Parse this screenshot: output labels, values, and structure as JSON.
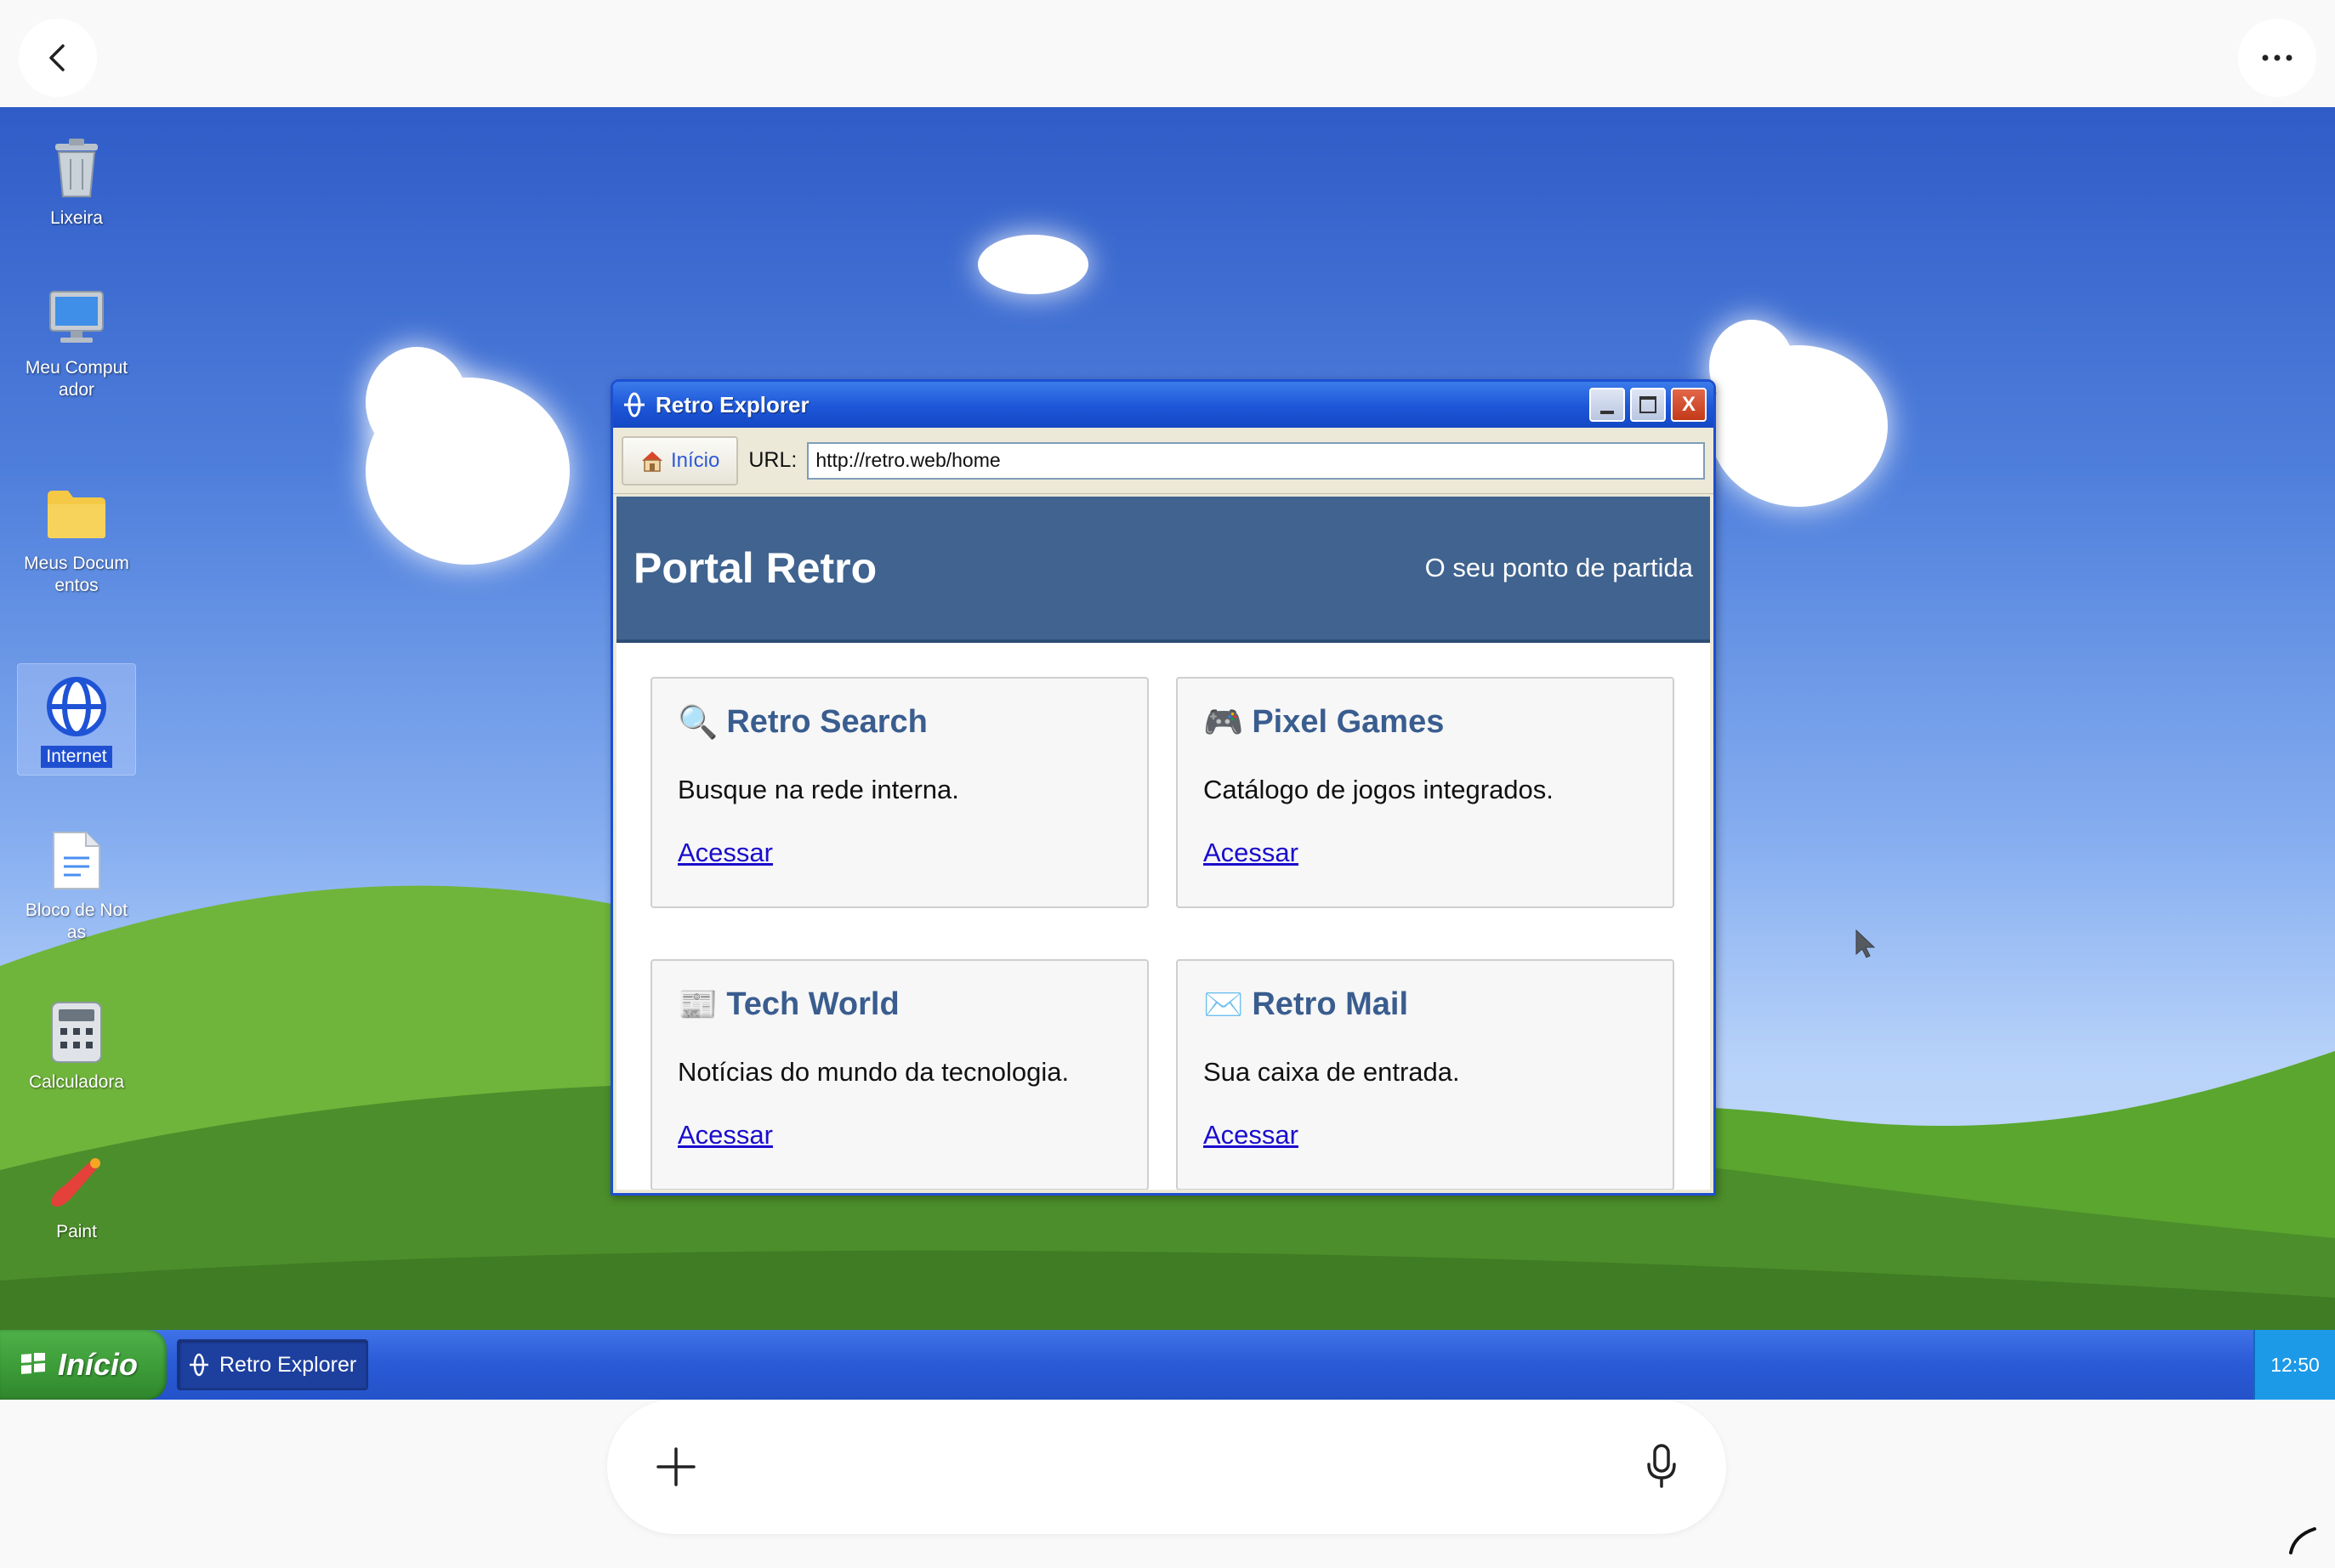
{
  "appbar": {
    "back_icon": "chevron-left-icon",
    "more_icon": "more-horizontal-icon"
  },
  "desktop": {
    "icons": [
      {
        "label": "Lixeira",
        "icon": "trash-icon"
      },
      {
        "label": "Meu Computador",
        "icon": "computer-icon"
      },
      {
        "label": "Meus Documentos",
        "icon": "folder-icon"
      },
      {
        "label": "Internet",
        "icon": "internet-globe-icon",
        "selected": true
      },
      {
        "label": "Bloco de Notas",
        "icon": "notepad-icon"
      },
      {
        "label": "Calculadora",
        "icon": "calculator-icon"
      },
      {
        "label": "Paint",
        "icon": "paint-brush-icon"
      }
    ]
  },
  "window": {
    "title": "Retro Explorer",
    "controls": {
      "minimize": "_",
      "maximize": "□",
      "close": "X"
    },
    "toolbar": {
      "home_label": "Início",
      "url_label": "URL:",
      "url_value": "http://retro.web/home"
    },
    "page": {
      "brand": "Portal Retro",
      "slogan": "O seu ponto de partida",
      "cards": [
        {
          "emoji": "🔍",
          "title": "Retro Search",
          "desc": "Busque na rede interna.",
          "link": "Acessar"
        },
        {
          "emoji": "🎮",
          "title": "Pixel Games",
          "desc": "Catálogo de jogos integrados.",
          "link": "Acessar"
        },
        {
          "emoji": "📰",
          "title": "Tech World",
          "desc": "Notícias do mundo da tecnologia.",
          "link": "Acessar"
        },
        {
          "emoji": "✉️",
          "title": "Retro Mail",
          "desc": "Sua caixa de entrada.",
          "link": "Acessar"
        }
      ]
    }
  },
  "taskbar": {
    "start_label": "Início",
    "task_label": "Retro Explorer",
    "clock": "12:50"
  },
  "colors": {
    "taskbar": "#2a5ad6",
    "start": "#3a9a36",
    "titlebar": "#1d56d8",
    "banner": "#40638f",
    "close": "#c23a1a"
  }
}
